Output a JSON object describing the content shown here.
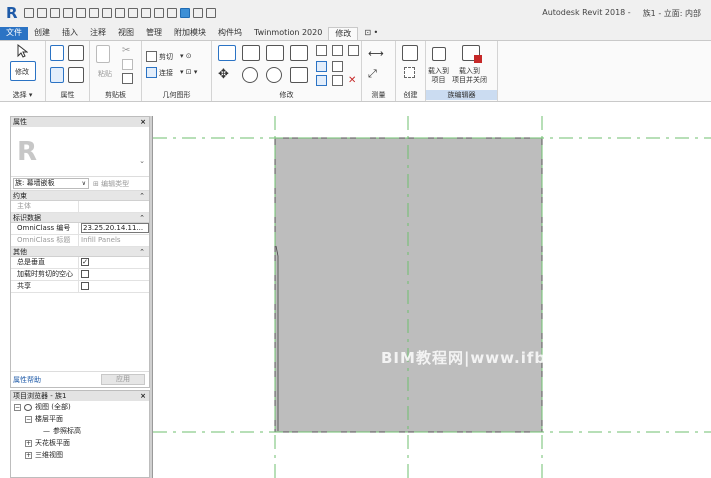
{
  "app": {
    "logo_letter": "R",
    "title": "Autodesk Revit 2018 -",
    "document": "族1 - 立面: 内部"
  },
  "tabs": [
    "文件",
    "创建",
    "插入",
    "注释",
    "视图",
    "管理",
    "附加模块",
    "构件坞",
    "Twinmotion 2020",
    "修改",
    "⊡ •"
  ],
  "ribbon": {
    "modify_label": "修改",
    "cut": "剪切",
    "join": "连接",
    "load_into_project": "载入到\n项目",
    "load_into_project_close": "载入到\n项目并关闭",
    "panels": {
      "select": "选择 ▾",
      "properties": "属性",
      "clipboard": "剪贴板",
      "geometry": "几何图形",
      "modify": "修改",
      "measure": "测量",
      "create": "创建",
      "family_editor": "族编辑器"
    }
  },
  "properties": {
    "header": "属性",
    "close": "×",
    "family_icon_letter": "R",
    "type_label": "族: 幕墙嵌板",
    "edit_type": "编辑类型",
    "groups": [
      {
        "name": "约束",
        "rows": [
          {
            "key": "主体",
            "value": ""
          }
        ]
      },
      {
        "name": "标识数据",
        "rows": [
          {
            "key": "OmniClass 编号",
            "value": "23.25.20.14.11..."
          },
          {
            "key": "OmniClass 标题",
            "value": "Infill Panels"
          }
        ]
      },
      {
        "name": "其他",
        "rows": [
          {
            "key": "总是垂直",
            "value": "checked"
          },
          {
            "key": "加载时剪切的空心",
            "value": ""
          },
          {
            "key": "共享",
            "value": ""
          }
        ]
      }
    ],
    "help_link": "属性帮助",
    "apply": "应用"
  },
  "browser": {
    "header": "项目浏览器 - 族1",
    "close": "×",
    "items": [
      {
        "label": "视图 (全部)",
        "toggle": "−"
      },
      {
        "label": "楼层平面",
        "toggle": "−"
      },
      {
        "label": "参照标高",
        "toggle": ""
      },
      {
        "label": "天花板平面",
        "toggle": "+"
      },
      {
        "label": "三维视图",
        "toggle": "+"
      }
    ]
  },
  "watermark": "BIM教程网|www.ifbim.com",
  "colors": {
    "panel_fill": "#bdbdbd",
    "reference_line": "#6fbf6f",
    "file_tab": "#2b73c4"
  }
}
